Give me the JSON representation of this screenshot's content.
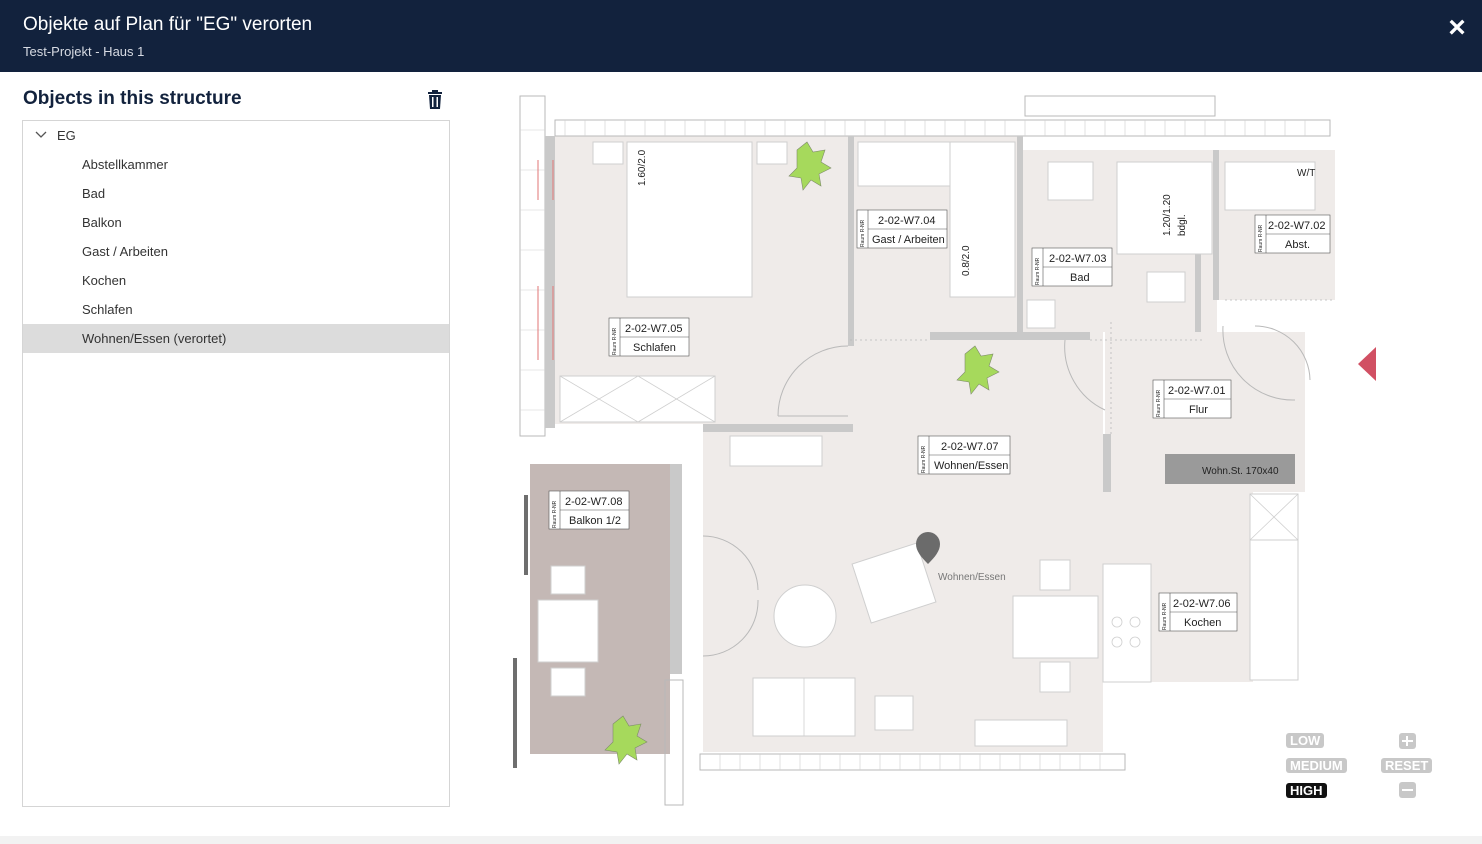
{
  "header": {
    "title": "Objekte auf Plan für \"EG\" verorten",
    "subtitle": "Test-Projekt - Haus 1",
    "close_label": "×"
  },
  "panel": {
    "title": "Objects in this structure",
    "tree": {
      "root_label": "EG",
      "items": [
        {
          "label": "Abstellkammer",
          "selected": false
        },
        {
          "label": "Bad",
          "selected": false
        },
        {
          "label": "Balkon",
          "selected": false
        },
        {
          "label": "Gast / Arbeiten",
          "selected": false
        },
        {
          "label": "Kochen",
          "selected": false
        },
        {
          "label": "Schlafen",
          "selected": false
        },
        {
          "label": "Wohnen/Essen (verortet)",
          "selected": true
        }
      ]
    }
  },
  "plan": {
    "rooms": [
      {
        "number": "2-02-W7.05",
        "name": "Schlafen",
        "tag": "Raum R-NR"
      },
      {
        "number": "2-02-W7.04",
        "name": "Gast / Arbeiten",
        "tag": "Raum R-NR"
      },
      {
        "number": "2-02-W7.03",
        "name": "Bad",
        "tag": "Raum R-NR"
      },
      {
        "number": "2-02-W7.02",
        "name": "Abst.",
        "tag": "Raum R-NR"
      },
      {
        "number": "2-02-W7.01",
        "name": "Flur",
        "tag": "Raum R-NR"
      },
      {
        "number": "2-02-W7.07",
        "name": "Wohnen/Essen",
        "tag": "Raum R-NR"
      },
      {
        "number": "2-02-W7.08",
        "name": "Balkon 1/2",
        "tag": "Raum R-NR"
      },
      {
        "number": "2-02-W7.06",
        "name": "Kochen",
        "tag": "Raum R-NR"
      }
    ],
    "dimension_labels": {
      "bed": "1.60/2.0",
      "door_guest": "0.8/2.0",
      "shower": "1.20/1.20",
      "shower_note": "bdgl.",
      "wt": "W/T",
      "wohn_st": "Wohn.St. 170x40"
    },
    "marker_label": "Wohnen/Essen",
    "colors": {
      "room_fill": "#efebe9",
      "balcony_fill": "#c4b8b5",
      "wall": "#b9b9b9",
      "plant": "#a6d95c",
      "marker": "#6b6b6b",
      "nav_arrow": "#d15063"
    }
  },
  "zoom": {
    "low": "LOW",
    "medium": "MEDIUM",
    "high": "HIGH",
    "reset": "RESET",
    "active": "HIGH"
  },
  "icons": {
    "close": "close-icon",
    "trash": "trash-icon",
    "chevron": "chevron-down-icon",
    "zoom_in": "zoom-in-icon",
    "zoom_out": "zoom-out-icon",
    "marker": "location-marker-icon"
  }
}
